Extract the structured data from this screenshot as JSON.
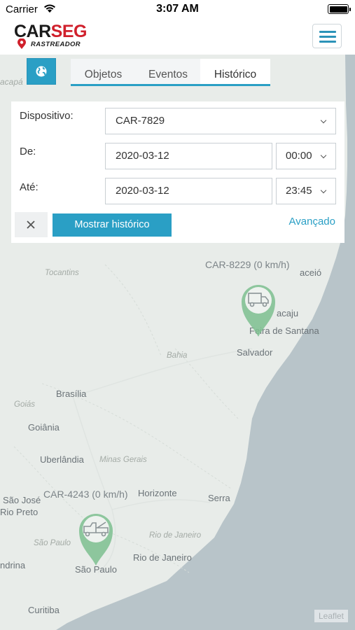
{
  "status_bar": {
    "carrier": "Carrier",
    "time": "3:07 AM"
  },
  "header": {
    "logo_main_1": "CAR",
    "logo_main_2": "SEG",
    "logo_sub": "RASTREADOR"
  },
  "tabs": [
    {
      "label": "Objetos",
      "active": false
    },
    {
      "label": "Eventos",
      "active": false
    },
    {
      "label": "Histórico",
      "active": true
    }
  ],
  "form": {
    "device_label": "Dispositivo:",
    "device_value": "CAR-7829",
    "from_label": "De:",
    "from_date": "2020-03-12",
    "from_time": "00:00",
    "to_label": "Até:",
    "to_date": "2020-03-12",
    "to_time": "23:45",
    "close_icon": "close-icon",
    "show_button": "Mostrar histórico",
    "advanced_link": "Avançado"
  },
  "map": {
    "vehicles": [
      {
        "label": "CAR-8229 (0 km/h)",
        "icon": "truck-icon"
      },
      {
        "label": "CAR-4243 (0 km/h)",
        "icon": "tow-truck-icon"
      }
    ],
    "places": {
      "macapa": "acapá",
      "tocantins": "Tocantins",
      "aracaju": "acaju",
      "feira": "Feira de Santana",
      "salvador": "Salvador",
      "bahia": "Bahia",
      "brasilia": "Brasília",
      "goias_state": "Goiás",
      "goiania": "Goiânia",
      "uberlandia": "Uberlândia",
      "minas": "Minas Gerais",
      "sao_jose": "São José",
      "rio_preto": "Rio Preto",
      "horizonte": "Horizonte",
      "serra": "Serra",
      "rio_state": "Rio de Janeiro",
      "rio": "Rio de Janeiro",
      "sao_paulo_state": "São Paulo",
      "sao_paulo": "São Paulo",
      "londrina": "ndrina",
      "curitiba": "Curitiba",
      "maceio": "aceió"
    },
    "attribution": "Leaflet",
    "colors": {
      "ocean": "#b8c4c9",
      "land": "#e8ece9",
      "marker": "#7cc08f",
      "accent": "#2a9fc5"
    }
  }
}
